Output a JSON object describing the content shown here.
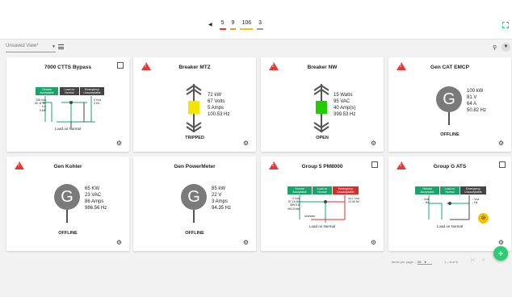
{
  "header": {
    "counts": [
      {
        "value": "5",
        "color": "#e53935"
      },
      {
        "value": "9",
        "color": "#f39c12"
      },
      {
        "value": "106",
        "color": "#f1c40f"
      },
      {
        "value": "3",
        "color": "#9b9b9b"
      }
    ]
  },
  "toolbar": {
    "view_value": "Unsaved View*"
  },
  "cards": {
    "c1": {
      "title": "7000 CTTS Bypass",
      "tags": [
        "Normal Acceptable",
        "Load on Neutral",
        "Emergency Unacceptable"
      ],
      "left_values": [
        "208 Vca",
        "60.11 Hz",
        "0 A",
        "0 kW"
      ],
      "right_values": [
        "0 Vca",
        "0 Hz"
      ],
      "load": "Load on Normal"
    },
    "c2": {
      "title": "Breaker MTZ",
      "readings": [
        "72 kW",
        "67 Volts",
        "5 Amps",
        "100.53 Hz"
      ],
      "status": "TRIPPED",
      "box_color": "#f2e600"
    },
    "c3": {
      "title": "Breaker NW",
      "readings": [
        "15 Watts",
        "95 VAC",
        "40 Amp(s)",
        "399.53 Hz"
      ],
      "status": "OPEN",
      "box_color": "#22cc00"
    },
    "c4": {
      "title": "Gen CAT EMCP",
      "letter": "G",
      "readings": [
        "100 kW",
        "81 V",
        "64 A",
        "50.82 Hz"
      ],
      "status": "OFFLINE"
    },
    "c5": {
      "title": "Gen Kohler",
      "letter": "G",
      "readings": [
        "65 KW",
        "23 VAC",
        "86 Amps",
        "986.56 Hz"
      ],
      "status": "OFFLINE"
    },
    "c6": {
      "title": "Gen PowerMeter",
      "letter": "G",
      "readings": [
        "85 kW",
        "22 V",
        "3 Amps",
        "94.35 Hz"
      ],
      "status": "OFFLINE"
    },
    "c7": {
      "title": "Group 5 PM8000",
      "tags": [
        "Normal Acceptable",
        "Load on Normal",
        "Emergency Unacceptable"
      ],
      "left_values": [
        "0 Vca",
        "57.19 Hz",
        "359.9 A",
        "992.6 kW"
      ],
      "right_values": [
        "44.1 Vca",
        "12.49 Hz"
      ],
      "middle": "Unmeter",
      "load": "Load on Normal"
    },
    "c8": {
      "title": "Group G ATS",
      "tags": [
        "Normal Acceptable",
        "Load on Normal",
        "Emergency Unacceptable"
      ],
      "left_values": [
        "- Vca",
        "- Hz"
      ],
      "right_values": [
        "- Vca",
        "- Hz"
      ],
      "load": "Load on Normal"
    }
  },
  "pagination": {
    "items_label": "Items per page:",
    "per_page": "25",
    "range": "1 – 8 of 8"
  },
  "colors": {
    "accent": "#2ecc71",
    "alert": "#e53935",
    "normal": "#1aa36a"
  }
}
